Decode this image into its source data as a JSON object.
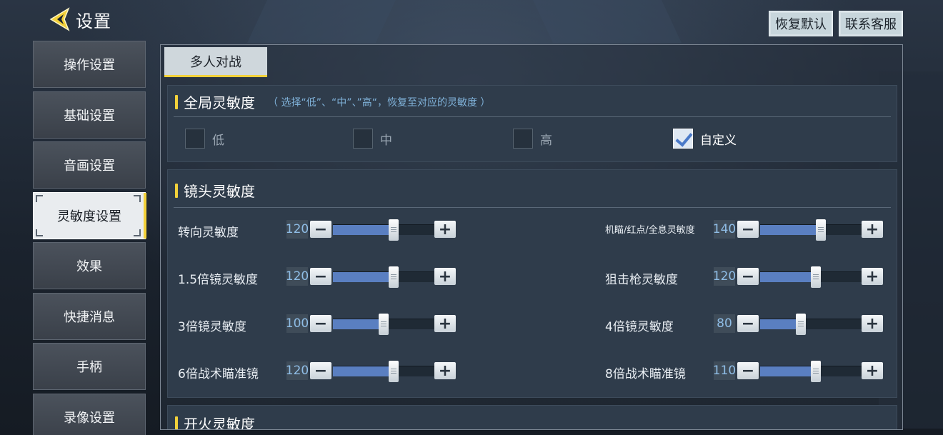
{
  "header": {
    "title": "设置"
  },
  "top_buttons": {
    "restore": "恢复默认",
    "support": "联系客服"
  },
  "sidebar": {
    "items": [
      {
        "label": "操作设置"
      },
      {
        "label": "基础设置"
      },
      {
        "label": "音画设置"
      },
      {
        "label": "灵敏度设置",
        "active": true
      },
      {
        "label": "效果"
      },
      {
        "label": "快捷消息"
      },
      {
        "label": "手柄"
      },
      {
        "label": "录像设置"
      }
    ]
  },
  "tabs": {
    "active": "多人对战"
  },
  "global": {
    "title": "全局灵敏度",
    "hint": "（ 选择“低”、“中”、”高“，恢复至对应的灵敏度 ）",
    "options": [
      {
        "label": "低",
        "checked": false
      },
      {
        "label": "中",
        "checked": false
      },
      {
        "label": "高",
        "checked": false
      },
      {
        "label": "自定义",
        "checked": true
      }
    ]
  },
  "camera": {
    "title": "镜头灵敏度",
    "sliders": [
      {
        "label": "转向灵敏度",
        "value": "120",
        "level": 0.6
      },
      {
        "label": "机瞄/红点/全息灵敏度",
        "value": "140",
        "level": 0.6
      },
      {
        "label": "1.5倍镜灵敏度",
        "value": "120",
        "level": 0.6
      },
      {
        "label": "狙击枪灵敏度",
        "value": "120",
        "level": 0.55
      },
      {
        "label": "3倍镜灵敏度",
        "value": "100",
        "level": 0.5
      },
      {
        "label": "4倍镜灵敏度",
        "value": "80",
        "level": 0.4
      },
      {
        "label": "6倍战术瞄准镜",
        "value": "120",
        "level": 0.6
      },
      {
        "label": "8倍战术瞄准镜",
        "value": "110",
        "level": 0.55
      }
    ]
  },
  "next_section": {
    "title": "开火灵敏度"
  },
  "controls": {
    "minus": "−",
    "plus": "+"
  }
}
